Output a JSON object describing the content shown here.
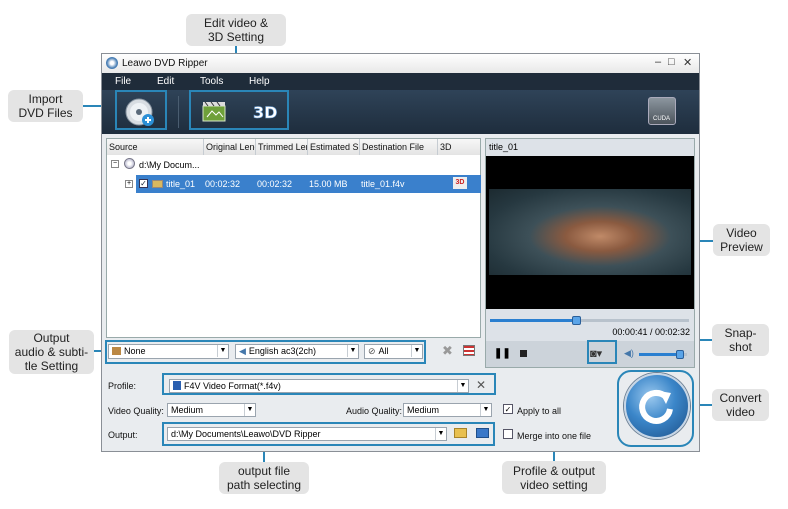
{
  "callouts": {
    "import": "Import\nDVD Files",
    "edit": "Edit video &\n3D Setting",
    "output_audio": "Output\naudio & subti-\ntle Setting",
    "video_preview": "Video\nPreview",
    "snapshot": "Snap-\nshot",
    "convert": "Convert\nvideo",
    "output_path": "output file\npath selecting",
    "profile_output": "Profile & output\nvideo setting"
  },
  "window": {
    "title": "Leawo DVD Ripper",
    "controls": [
      "–",
      "□",
      "✕"
    ],
    "menu": [
      "File",
      "Edit",
      "Tools",
      "Help"
    ],
    "cuda_badge": "CUDA"
  },
  "file_list": {
    "columns": [
      "Source",
      "Original Leng",
      "Trimmed Ler",
      "Estimated Si",
      "Destination File",
      "3D"
    ],
    "source_path": "d:\\My Docum...",
    "row": {
      "title": "title_01",
      "original_length": "00:02:32",
      "trimmed_length": "00:02:32",
      "estimated_size": "15.00 MB",
      "destination": "title_01.f4v",
      "three_d": "3D"
    }
  },
  "track_bar": {
    "subtitle": "None",
    "audio": "English ac3(2ch)",
    "filter": "All"
  },
  "preview": {
    "title": "title_01",
    "time": "00:00:41 / 00:02:32",
    "progress": 0.43,
    "volume": 0.85
  },
  "settings": {
    "profile_label": "Profile:",
    "profile_value": "F4V Video Format(*.f4v)",
    "video_quality_label": "Video Quality:",
    "video_quality": "Medium",
    "audio_quality_label": "Audio Quality:",
    "audio_quality": "Medium",
    "apply_all": "Apply to all",
    "output_label": "Output:",
    "output_path": "d:\\My Documents\\Leawo\\DVD Ripper",
    "merge": "Merge into one file"
  },
  "colors": {
    "accent": "#2a86b8",
    "selected_row": "#3a80cc",
    "toolbar": "#243649"
  }
}
